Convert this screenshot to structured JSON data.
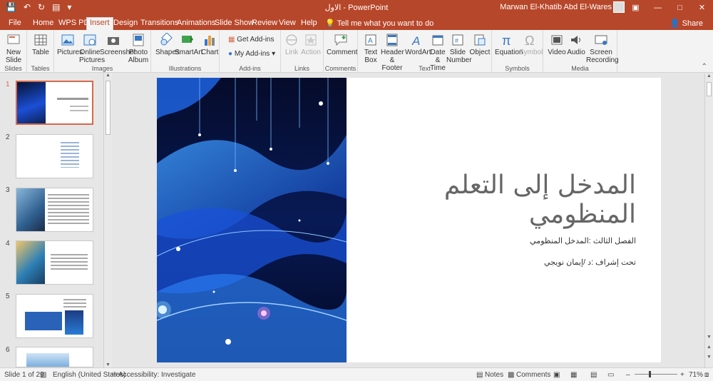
{
  "titlebar": {
    "doc_title": "الاول - PowerPoint",
    "user": "Marwan El-Khatib Abd El-Wares",
    "minimize": "—",
    "restore": "□",
    "close": "✕",
    "ribbon_display": "▣"
  },
  "tabs": [
    "File",
    "Home",
    "WPS PDF",
    "Insert",
    "Design",
    "Transitions",
    "Animations",
    "Slide Show",
    "Review",
    "View",
    "Help"
  ],
  "tell_me": "Tell me what you want to do",
  "share": "Share",
  "ribbon": {
    "slides": {
      "label": "Slides",
      "new_slide": "New Slide"
    },
    "tables": {
      "label": "Tables",
      "table": "Table"
    },
    "images": {
      "label": "Images",
      "pictures": "Pictures",
      "online_pictures": "Online Pictures",
      "screenshot": "Screenshot",
      "photo_album": "Photo Album"
    },
    "illustrations": {
      "label": "Illustrations",
      "shapes": "Shapes",
      "smartart": "SmartArt",
      "chart": "Chart"
    },
    "addins": {
      "label": "Add-ins",
      "get": "Get Add-ins",
      "my": "My Add-ins"
    },
    "links": {
      "label": "Links",
      "link": "Link",
      "action": "Action"
    },
    "comments": {
      "label": "Comments",
      "comment": "Comment"
    },
    "text": {
      "label": "Text",
      "text_box": "Text Box",
      "header_footer": "Header & Footer",
      "wordart": "WordArt",
      "date_time": "Date & Time",
      "slide_number": "Slide Number",
      "object": "Object"
    },
    "symbols": {
      "label": "Symbols",
      "equation": "Equation",
      "symbol": "Symbol"
    },
    "media": {
      "label": "Media",
      "video": "Video",
      "audio": "Audio",
      "screen_recording": "Screen Recording"
    }
  },
  "thumbnails": [
    "1",
    "2",
    "3",
    "4",
    "5",
    "6"
  ],
  "slide": {
    "title": "المدخل إلى التعلم المنظومي",
    "subtitle1": "الفصل الثالث :المدخل المنظومي",
    "subtitle2": "تحت إشراف :د /إيمان نويجي"
  },
  "status": {
    "slide_count": "Slide 1 of 29",
    "language": "English (United States)",
    "accessibility": "Accessibility: Investigate",
    "notes": "Notes",
    "comments": "Comments",
    "zoom": "71%",
    "zoom_fraction": 0.71
  },
  "colors": {
    "accent": "#b7472a",
    "slide_bg": "#0a1530",
    "wave": "#1e6bff"
  }
}
